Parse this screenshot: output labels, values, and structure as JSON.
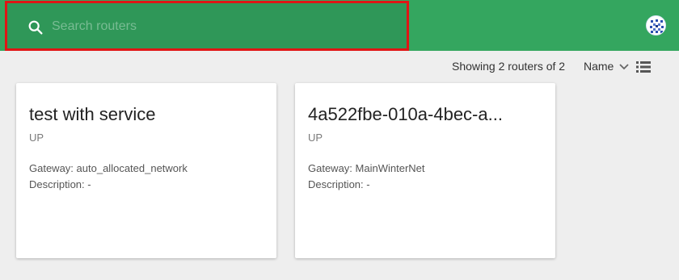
{
  "search": {
    "placeholder": "Search routers",
    "icon": "search-icon"
  },
  "header": {
    "background": "#34a65f",
    "avatar_icon": "user-avatar"
  },
  "toolbar": {
    "count_text": "Showing 2 routers of 2",
    "sort_label": "Name",
    "sort_icon": "chevron-down-icon",
    "view_icon": "list-view-icon"
  },
  "routers": [
    {
      "name": "test with service",
      "status": "UP",
      "gateway_label": "Gateway:",
      "gateway": "auto_allocated_network",
      "description_label": "Description:",
      "description": "-"
    },
    {
      "name": "4a522fbe-010a-4bec-a...",
      "status": "UP",
      "gateway_label": "Gateway:",
      "gateway": "MainWinterNet",
      "description_label": "Description:",
      "description": "-"
    }
  ]
}
